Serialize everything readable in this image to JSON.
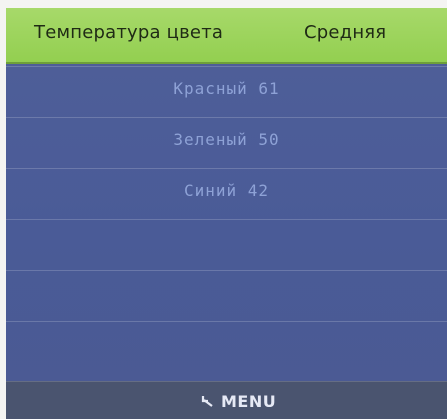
{
  "header": {
    "title": "Температура цвета",
    "value": "Средняя"
  },
  "list": {
    "items": [
      {
        "label": "Красный 61"
      },
      {
        "label": "Зеленый 50"
      },
      {
        "label": "Синий 42"
      },
      {
        "label": ""
      },
      {
        "label": ""
      },
      {
        "label": ""
      }
    ]
  },
  "footer": {
    "menu_label": "MENU",
    "menu_icon": "return-arrow-icon"
  },
  "colors": {
    "header_bg": "#9fd35e",
    "list_bg": "#4d5d98",
    "row_text": "#8ea2d6",
    "footer_bg": "#4a546f"
  }
}
